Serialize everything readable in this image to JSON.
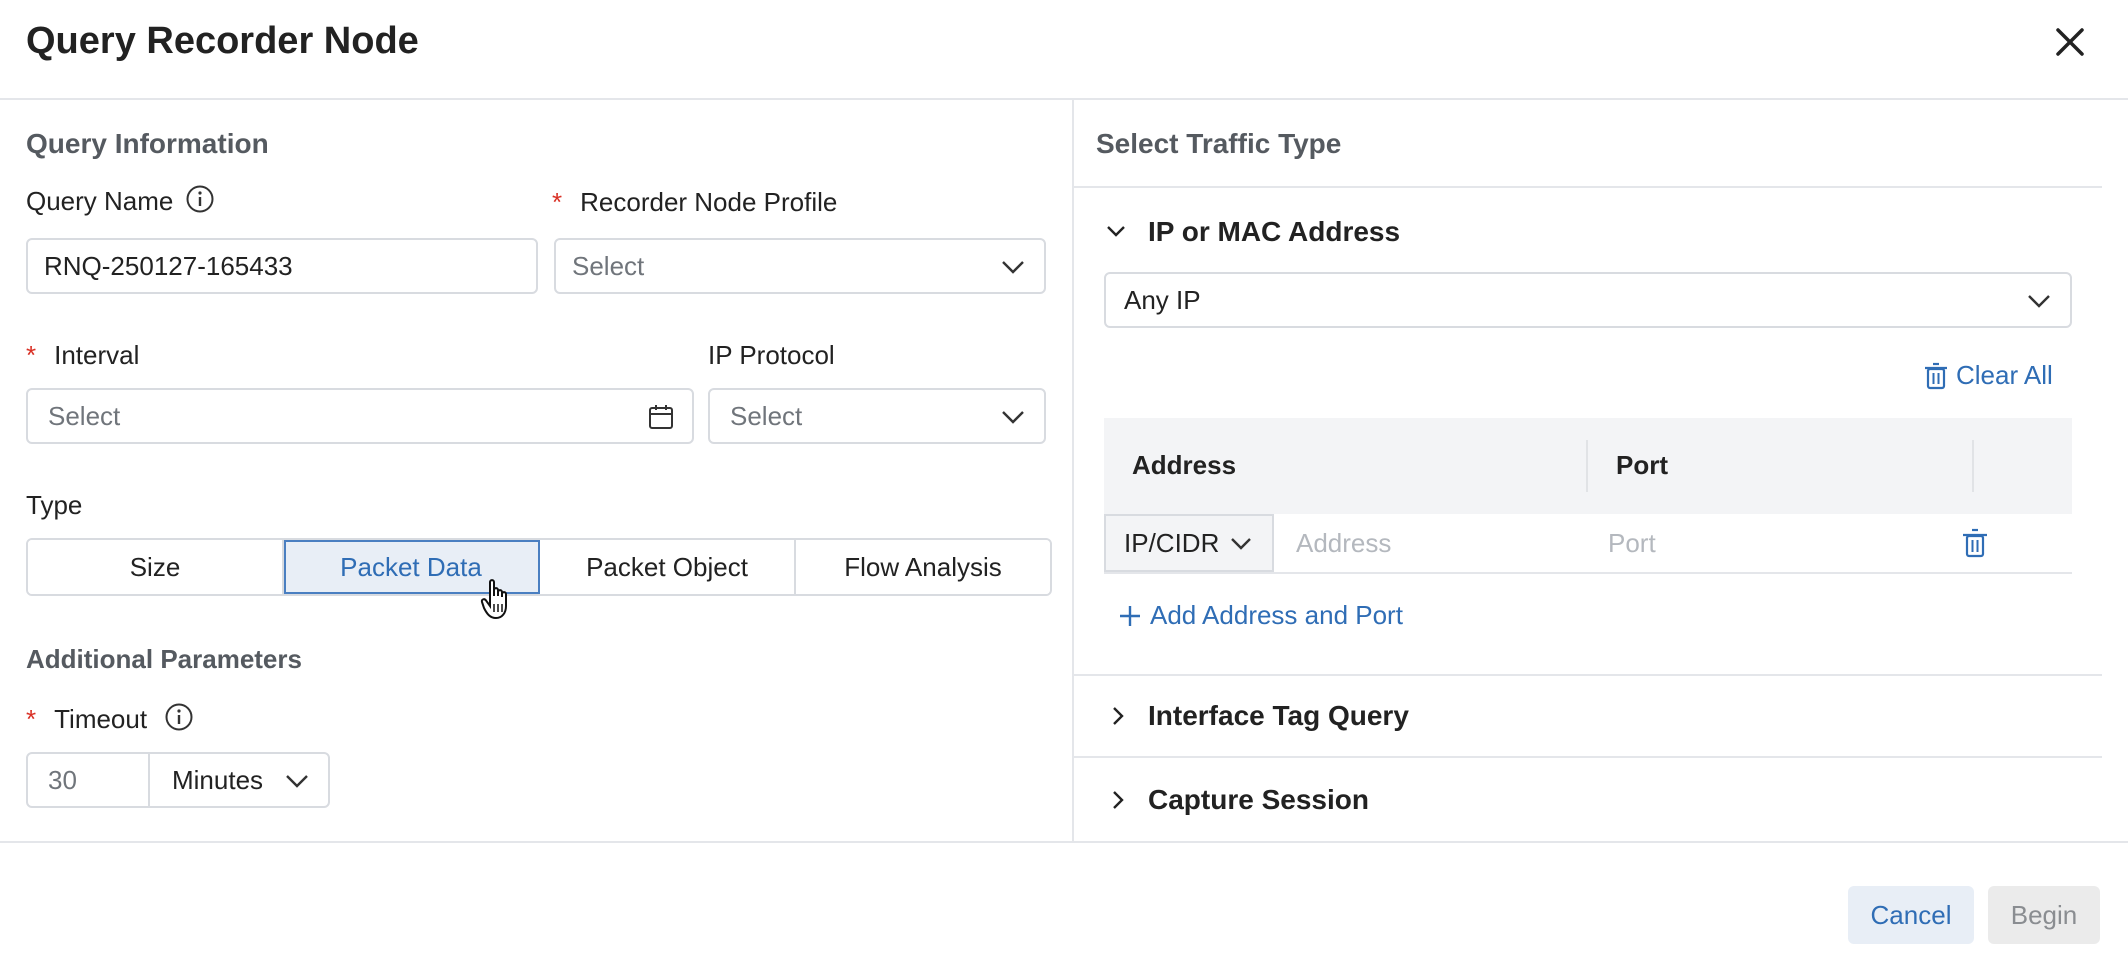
{
  "dialog": {
    "title": "Query Recorder Node"
  },
  "query_info": {
    "section_title": "Query Information",
    "query_name_label": "Query Name",
    "query_name_value": "RNQ-250127-165433",
    "profile_label": "Recorder Node Profile",
    "profile_value": "Select",
    "interval_label": "Interval",
    "interval_value": "Select",
    "protocol_label": "IP Protocol",
    "protocol_value": "Select",
    "required_mark": "*",
    "type_label": "Type",
    "type_options": [
      "Size",
      "Packet Data",
      "Packet Object",
      "Flow Analysis"
    ],
    "type_selected": "Packet Data",
    "additional_title": "Additional Parameters",
    "timeout_label": "Timeout",
    "timeout_value": "30",
    "timeout_unit": "Minutes"
  },
  "traffic": {
    "section_title": "Select Traffic Type",
    "ip_mac_title": "IP or MAC Address",
    "address_filter": "Any IP",
    "clear_all": "Clear All",
    "table_headers": [
      "Address",
      "Port"
    ],
    "row_type": "IP/CIDR",
    "address_placeholder": "Address",
    "port_placeholder": "Port",
    "add_link": "Add Address and Port",
    "interface_title": "Interface Tag Query",
    "capture_title": "Capture Session"
  },
  "footer": {
    "cancel_label": "Cancel",
    "begin_label": "Begin"
  },
  "colors": {
    "accent": "#2f6db5",
    "required": "#d93025",
    "border": "#d8dbe0"
  }
}
